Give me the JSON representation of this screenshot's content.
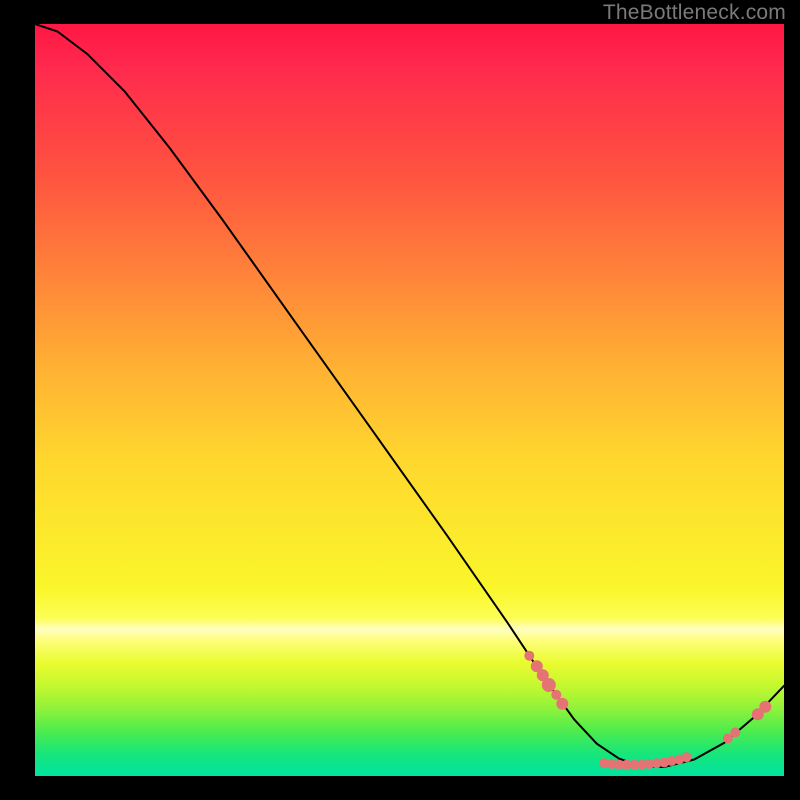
{
  "watermark": "TheBottleneck.com",
  "colors": {
    "dot": "#e57373",
    "curve": "#000000",
    "top": "#ff1744",
    "bottom": "#00e3a1"
  },
  "chart_data": {
    "type": "line",
    "title": "",
    "xlabel": "",
    "ylabel": "",
    "xlim": [
      0,
      100
    ],
    "ylim": [
      0,
      100
    ],
    "curve": [
      {
        "x": 0.0,
        "y": 100.0
      },
      {
        "x": 3.0,
        "y": 99.0
      },
      {
        "x": 7.0,
        "y": 96.0
      },
      {
        "x": 12.0,
        "y": 91.0
      },
      {
        "x": 18.0,
        "y": 83.5
      },
      {
        "x": 25.0,
        "y": 74.0
      },
      {
        "x": 35.0,
        "y": 60.0
      },
      {
        "x": 45.0,
        "y": 46.0
      },
      {
        "x": 55.0,
        "y": 32.0
      },
      {
        "x": 63.0,
        "y": 20.5
      },
      {
        "x": 68.0,
        "y": 13.0
      },
      {
        "x": 72.0,
        "y": 7.5
      },
      {
        "x": 75.0,
        "y": 4.3
      },
      {
        "x": 78.0,
        "y": 2.3
      },
      {
        "x": 81.0,
        "y": 1.3
      },
      {
        "x": 84.0,
        "y": 1.2
      },
      {
        "x": 88.0,
        "y": 2.2
      },
      {
        "x": 92.0,
        "y": 4.4
      },
      {
        "x": 96.0,
        "y": 7.8
      },
      {
        "x": 100.0,
        "y": 12.0
      }
    ],
    "points": [
      {
        "x": 66.0,
        "y": 16.0,
        "r": 5
      },
      {
        "x": 67.0,
        "y": 14.6,
        "r": 6
      },
      {
        "x": 67.8,
        "y": 13.4,
        "r": 6
      },
      {
        "x": 68.6,
        "y": 12.1,
        "r": 7
      },
      {
        "x": 69.6,
        "y": 10.8,
        "r": 5
      },
      {
        "x": 70.4,
        "y": 9.6,
        "r": 6
      },
      {
        "x": 76.0,
        "y": 1.7,
        "r": 5
      },
      {
        "x": 77.0,
        "y": 1.6,
        "r": 5
      },
      {
        "x": 78.0,
        "y": 1.5,
        "r": 5
      },
      {
        "x": 79.0,
        "y": 1.5,
        "r": 5
      },
      {
        "x": 80.0,
        "y": 1.5,
        "r": 5
      },
      {
        "x": 81.0,
        "y": 1.5,
        "r": 5
      },
      {
        "x": 82.0,
        "y": 1.6,
        "r": 5
      },
      {
        "x": 83.0,
        "y": 1.7,
        "r": 5
      },
      {
        "x": 84.0,
        "y": 1.8,
        "r": 5
      },
      {
        "x": 85.0,
        "y": 2.0,
        "r": 5
      },
      {
        "x": 86.0,
        "y": 2.2,
        "r": 5
      },
      {
        "x": 87.0,
        "y": 2.5,
        "r": 5
      },
      {
        "x": 92.5,
        "y": 5.0,
        "r": 5
      },
      {
        "x": 93.5,
        "y": 5.8,
        "r": 5
      },
      {
        "x": 96.5,
        "y": 8.2,
        "r": 6
      },
      {
        "x": 97.5,
        "y": 9.2,
        "r": 6
      }
    ]
  }
}
